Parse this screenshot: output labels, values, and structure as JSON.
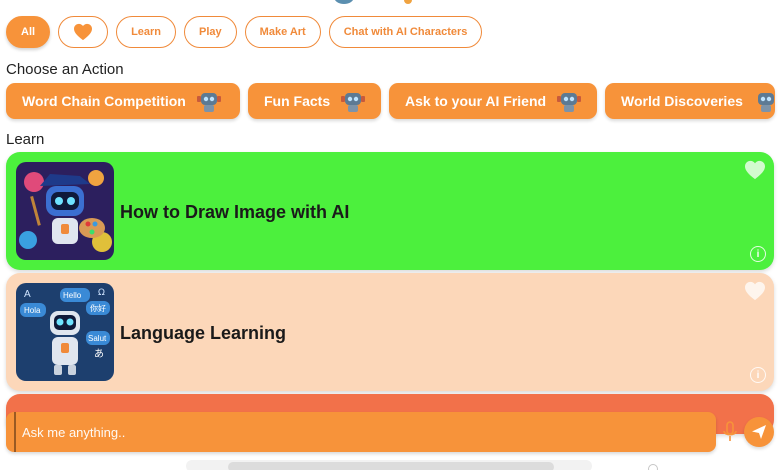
{
  "filters": [
    {
      "label": "All",
      "active": true
    },
    {
      "label": "",
      "icon": "heart-icon",
      "active": false
    },
    {
      "label": "Learn",
      "active": false
    },
    {
      "label": "Play",
      "active": false
    },
    {
      "label": "Make Art",
      "active": false
    },
    {
      "label": "Chat with AI Characters",
      "active": false
    }
  ],
  "actions_section": {
    "title": "Choose an Action",
    "items": [
      {
        "label": "Word Chain Competition",
        "icon": "robot-icon"
      },
      {
        "label": "Fun Facts",
        "icon": "robot-icon"
      },
      {
        "label": "Ask to your AI Friend",
        "icon": "robot-icon"
      },
      {
        "label": "World Discoveries",
        "icon": "robot-icon"
      }
    ]
  },
  "learn_section": {
    "title": "Learn",
    "cards": [
      {
        "title": "How to Draw Image with AI",
        "color": "#4cf03d",
        "image": "robot-painter-illustration"
      },
      {
        "title": "Language Learning",
        "color": "#fcd7b9",
        "image": "robot-languages-illustration",
        "thumb_words": [
          "Hola",
          "Hello",
          "你好",
          "Salut",
          "あ",
          "A",
          "Ω"
        ]
      },
      {
        "title": "",
        "color": "#f2714a"
      }
    ]
  },
  "chat": {
    "placeholder": "Ask me anything.."
  },
  "colors": {
    "accent": "#f7933a",
    "white": "#ffffff"
  }
}
